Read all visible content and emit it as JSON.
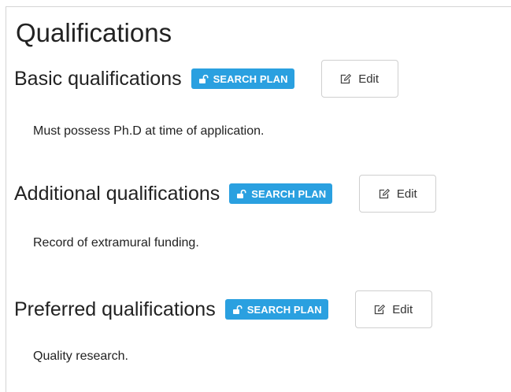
{
  "page": {
    "title": "Qualifications"
  },
  "sections": [
    {
      "title": "Basic qualifications",
      "badge_label": "SEARCH PLAN",
      "edit_label": "Edit",
      "text": "Must possess Ph.D at time of application."
    },
    {
      "title": "Additional qualifications",
      "badge_label": "SEARCH PLAN",
      "edit_label": "Edit",
      "text": "Record of extramural funding."
    },
    {
      "title": "Preferred qualifications",
      "badge_label": "SEARCH PLAN",
      "edit_label": "Edit",
      "text": "Quality research."
    }
  ],
  "icons": {
    "badge_icon": "unlock-icon",
    "edit_icon": "edit-icon"
  },
  "colors": {
    "badge_background": "#2aa0e0",
    "badge_text": "#ffffff",
    "panel_border": "#d4d4d4",
    "button_border": "#cfcfcf"
  }
}
